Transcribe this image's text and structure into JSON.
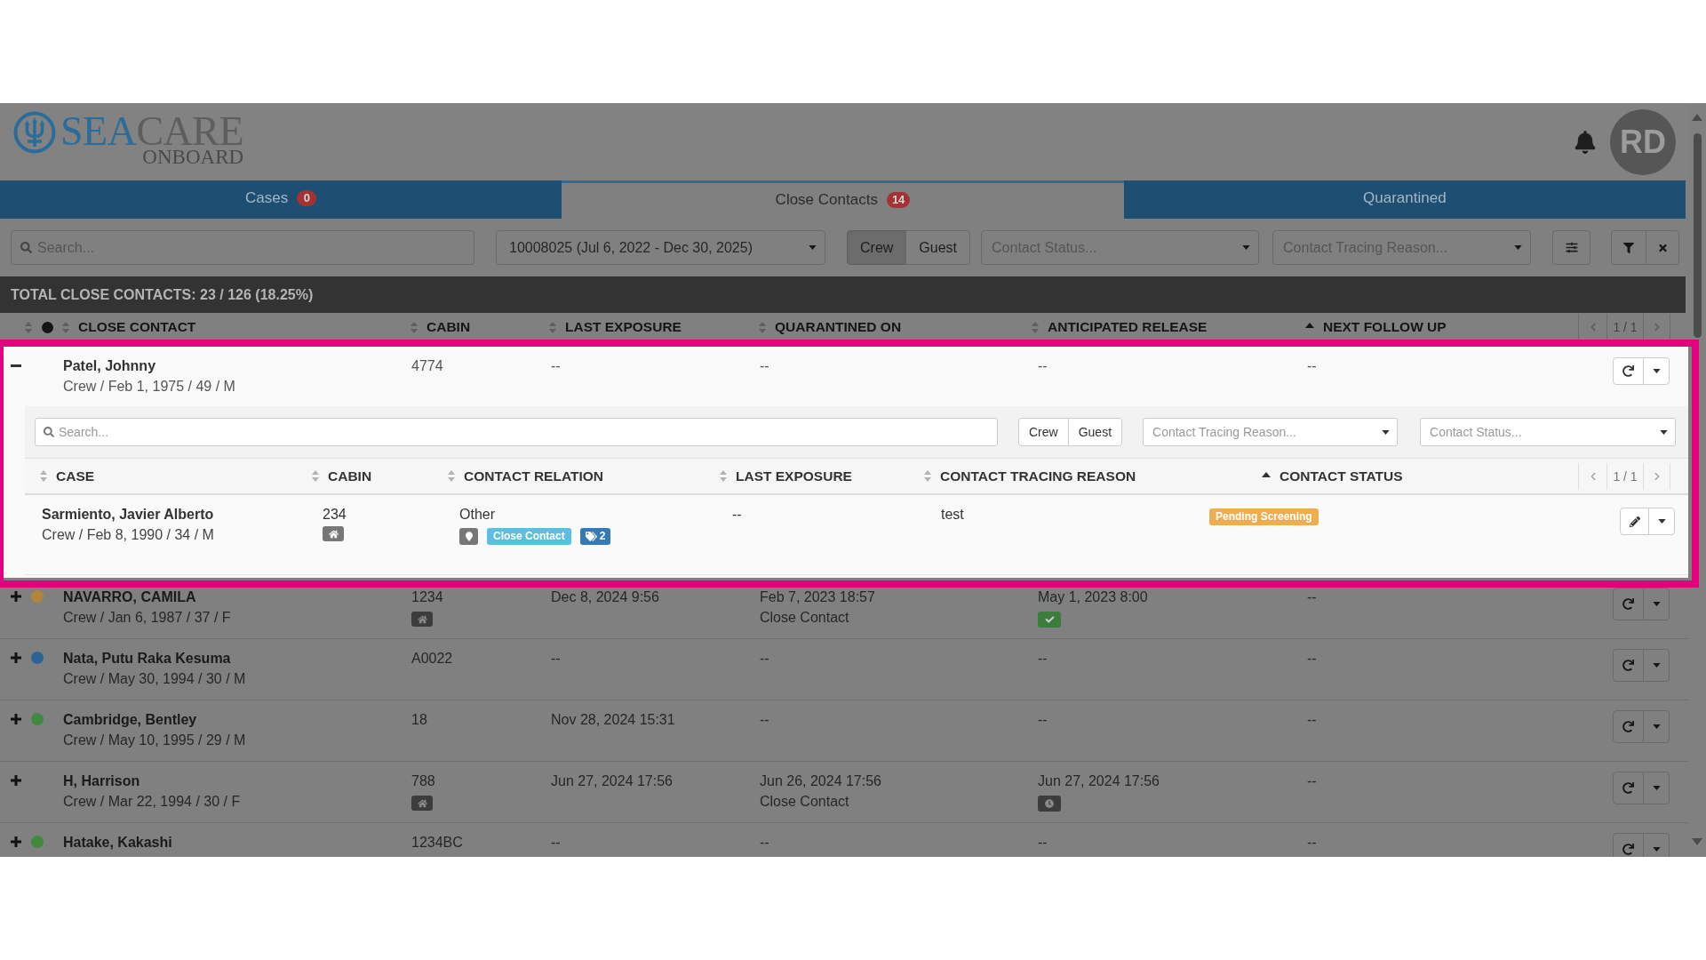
{
  "header": {
    "logo": {
      "word_1": "SEA",
      "word_2": "CARE",
      "tagline": "ONBOARD"
    },
    "avatar": {
      "initials": "RD"
    }
  },
  "tabs": [
    {
      "label": "Cases",
      "count": "0",
      "selected": false
    },
    {
      "label": "Close Contacts",
      "count": "14",
      "selected": true
    },
    {
      "label": "Quarantined",
      "selected": false
    }
  ],
  "filters": {
    "search": {
      "placeholder": "Search..."
    },
    "voyage": {
      "value": "10008025 (Jul 6, 2022 - Dec 30, 2025)"
    },
    "person_type": [
      {
        "label": "Crew",
        "selected": true
      },
      {
        "label": "Guest",
        "selected": false
      }
    ],
    "contact_status": {
      "placeholder": "Contact Status..."
    },
    "contact_tracing_reason": {
      "placeholder": "Contact Tracing Reason..."
    }
  },
  "summary": "TOTAL CLOSE CONTACTS: 23 / 126 (18.25%)",
  "table": {
    "columns": [
      {
        "kind": "dot",
        "sorted": false
      },
      {
        "kind": "label",
        "label": "CLOSE CONTACT",
        "sorted": false
      },
      {
        "kind": "label",
        "label": "CABIN",
        "sorted": false
      },
      {
        "kind": "label",
        "label": "LAST EXPOSURE",
        "sorted": false
      },
      {
        "kind": "label",
        "label": "QUARANTINED ON",
        "sorted": false
      },
      {
        "kind": "label",
        "label": "ANTICIPATED RELEASE",
        "sorted": false
      },
      {
        "kind": "label",
        "label": "NEXT FOLLOW UP",
        "sorted": true
      }
    ],
    "pagination": "1 / 1",
    "rows": [
      {
        "highlighted": true,
        "expanded": true,
        "name": "Patel, Johnny",
        "details": "Crew / Feb 1, 1975 / 49 / M",
        "cabin": "4774",
        "cabin_badge": false,
        "last_exposure": "--",
        "quarantined_on": "--",
        "anticipated_release": "--",
        "next_follow_up": "--",
        "contacts": {
          "search": {
            "placeholder": "Search..."
          },
          "person_type": [
            {
              "label": "Crew",
              "selected": false
            },
            {
              "label": "Guest",
              "selected": false
            }
          ],
          "contact_tracing_reason": {
            "placeholder": "Contact Tracing Reason..."
          },
          "contact_status": {
            "placeholder": "Contact Status..."
          },
          "columns": [
            {
              "label": "CASE",
              "sorted": false
            },
            {
              "label": "CABIN",
              "sorted": false
            },
            {
              "label": "CONTACT RELATION",
              "sorted": false
            },
            {
              "label": "LAST EXPOSURE",
              "sorted": false
            },
            {
              "label": "CONTACT TRACING REASON",
              "sorted": false
            },
            {
              "label": "CONTACT STATUS",
              "sorted": true
            }
          ],
          "pagination": "1 / 1",
          "rows": [
            {
              "name": "Sarmiento, Javier Alberto",
              "details": "Crew / Feb 8, 1990 / 34 / M",
              "cabin": "234",
              "cabin_badge": true,
              "relation": "Other",
              "tags": [
                {
                  "kind": "location"
                },
                {
                  "kind": "label",
                  "text": "Close Contact"
                },
                {
                  "kind": "count",
                  "text": "2"
                }
              ],
              "last_exposure": "--",
              "tracing_reason": "test",
              "status": "Pending Screening"
            }
          ]
        }
      },
      {
        "highlighted": false,
        "expanded": false,
        "color": "#b3843c",
        "name": "NAVARRO, CAMILA",
        "details": "Crew / Jan 6, 1987 / 37 / F",
        "cabin": "1234",
        "cabin_badge": true,
        "last_exposure": "Dec 8, 2024 9:56",
        "quarantined_on": "Feb 7, 2023 18:57",
        "quarantine_reason": "Close Contact",
        "anticipated_release": "May 1, 2023 8:00",
        "release_badge": {
          "kind": "check"
        },
        "next_follow_up": "--"
      },
      {
        "highlighted": false,
        "expanded": false,
        "color": "#2c6396",
        "name": "Nata, Putu Raka Kesuma",
        "details": "Crew / May 30, 1994 / 30 / M",
        "cabin": "A0022",
        "cabin_badge": false,
        "last_exposure": "--",
        "quarantined_on": "--",
        "anticipated_release": "--",
        "next_follow_up": "--"
      },
      {
        "highlighted": false,
        "expanded": false,
        "color": "#3f8a3f",
        "name": "Cambridge, Bentley",
        "details": "Crew / May 10, 1995 / 29 / M",
        "cabin": "18",
        "cabin_badge": false,
        "last_exposure": "Nov 28, 2024 15:31",
        "quarantined_on": "--",
        "anticipated_release": "--",
        "next_follow_up": "--"
      },
      {
        "highlighted": false,
        "expanded": false,
        "name": "H, Harrison",
        "details": "Crew / Mar 22, 1994 / 30 / F",
        "cabin": "788",
        "cabin_badge": true,
        "last_exposure": "Jun 27, 2024 17:56",
        "quarantined_on": "Jun 26, 2024 17:56",
        "quarantine_reason": "Close Contact",
        "anticipated_release": "Jun 27, 2024 17:56",
        "release_badge": {
          "kind": "clock"
        },
        "next_follow_up": "--"
      },
      {
        "highlighted": false,
        "expanded": false,
        "color": "#3f8a3f",
        "name": "Hatake, Kakashi",
        "cabin": "1234BC",
        "cabin_badge": false,
        "last_exposure": "--",
        "quarantined_on": "--",
        "anticipated_release": "--",
        "next_follow_up": "--"
      }
    ]
  }
}
